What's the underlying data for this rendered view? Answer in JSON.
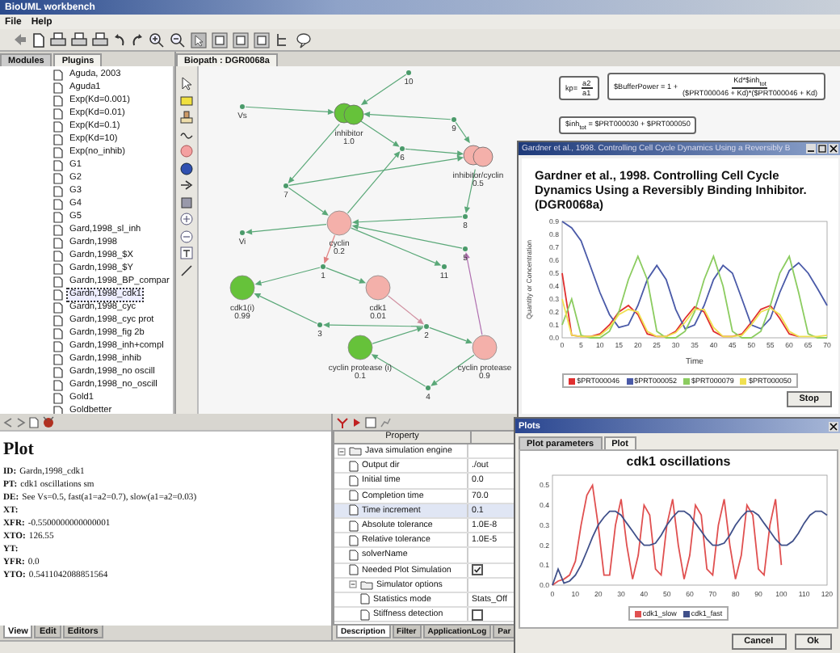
{
  "window": {
    "title": "BioUML workbench"
  },
  "menu": [
    "File",
    "Help"
  ],
  "left_panel": {
    "tabs": [
      {
        "label": "Modules",
        "selected": false
      },
      {
        "label": "Plugins",
        "selected": true
      }
    ],
    "tree": [
      {
        "label": "Aguda, 2003",
        "selected": false
      },
      {
        "label": "Aguda1",
        "selected": false
      },
      {
        "label": "Exp(Kd=0.001)",
        "selected": false
      },
      {
        "label": "Exp(Kd=0.01)",
        "selected": false
      },
      {
        "label": "Exp(Kd=0.1)",
        "selected": false
      },
      {
        "label": "Exp(Kd=10)",
        "selected": false
      },
      {
        "label": "Exp(no_inhib)",
        "selected": false
      },
      {
        "label": "G1",
        "selected": false
      },
      {
        "label": "G2",
        "selected": false
      },
      {
        "label": "G3",
        "selected": false
      },
      {
        "label": "G4",
        "selected": false
      },
      {
        "label": "G5",
        "selected": false
      },
      {
        "label": "Gard,1998_sl_inh",
        "selected": false
      },
      {
        "label": "Gardn,1998",
        "selected": false
      },
      {
        "label": "Gardn,1998_$X",
        "selected": false
      },
      {
        "label": "Gardn,1998_$Y",
        "selected": false
      },
      {
        "label": "Gardn,1998_BP_compar",
        "selected": false
      },
      {
        "label": "Gardn,1998_cdk1",
        "selected": true
      },
      {
        "label": "Gardn,1998_cyc",
        "selected": false
      },
      {
        "label": "Gardn,1998_cyc prot",
        "selected": false
      },
      {
        "label": "Gardn,1998_fig 2b",
        "selected": false
      },
      {
        "label": "Gardn,1998_inh+compl",
        "selected": false
      },
      {
        "label": "Gardn,1998_inhib",
        "selected": false
      },
      {
        "label": "Gardn,1998_no oscill",
        "selected": false
      },
      {
        "label": "Gardn,1998_no_oscill",
        "selected": false
      },
      {
        "label": "Gold1",
        "selected": false
      },
      {
        "label": "Goldbetter",
        "selected": false
      }
    ]
  },
  "diagram": {
    "tab": {
      "label": "Biopath : DGR0068a",
      "selected": true
    },
    "nodes": [
      {
        "kind": "reaction",
        "label": "10"
      },
      {
        "kind": "reaction",
        "label": "Vs"
      },
      {
        "kind": "complex",
        "label": "inhibitor",
        "value": "1.0",
        "color": "#66c23a"
      },
      {
        "kind": "reaction",
        "label": "9"
      },
      {
        "kind": "complex",
        "label": "inhibitor/cyclin",
        "value": "0.5",
        "color": "#f4b0aa"
      },
      {
        "kind": "reaction",
        "label": "6"
      },
      {
        "kind": "reaction",
        "label": "7"
      },
      {
        "kind": "species",
        "label": "cyclin",
        "value": "0.2",
        "color": "#f4b0aa"
      },
      {
        "kind": "reaction",
        "label": "8"
      },
      {
        "kind": "reaction",
        "label": "Vi"
      },
      {
        "kind": "reaction",
        "label": "5"
      },
      {
        "kind": "reaction",
        "label": "11"
      },
      {
        "kind": "reaction",
        "label": "1"
      },
      {
        "kind": "species",
        "label": "cdk1(i)",
        "value": "0.99",
        "color": "#66c23a"
      },
      {
        "kind": "species",
        "label": "cdk1",
        "value": "0.01",
        "color": "#f4b0aa"
      },
      {
        "kind": "reaction",
        "label": "3"
      },
      {
        "kind": "reaction",
        "label": "2"
      },
      {
        "kind": "species",
        "label": "cyclin protease (i)",
        "value": "0.1",
        "color": "#66c23a"
      },
      {
        "kind": "species",
        "label": "cyclin protease",
        "value": "0.9",
        "color": "#f4b0aa"
      },
      {
        "kind": "reaction",
        "label": "4"
      }
    ],
    "formulas": [
      {
        "lhs": "kp=",
        "numerator": "a2",
        "denominator": "a1"
      },
      {
        "lhs": "$BufferPower = 1 +",
        "numerator": "Kd*$inh$_{tot}$",
        "denominator": "($PRT000046 + Kd)*($PRT000046 + Kd)"
      },
      {
        "lhs": "$inh$_{tot}$ = $PRT000030 + $PRT000050"
      }
    ]
  },
  "result_window": {
    "title": "Gardner et al., 1998. Controlling Cell Cycle Dynamics Using a Reversibly B",
    "chart_data": {
      "type": "line",
      "title": "Gardner et al., 1998. Controlling Cell Cycle Dynamics Using a Reversibly Binding Inhibitor. (DGR0068a)",
      "xlabel": "Time",
      "ylabel": "Quantity or Concentration",
      "x": [
        0,
        2.5,
        5,
        7.5,
        10,
        12.5,
        15,
        17.5,
        20,
        22.5,
        25,
        27.5,
        30,
        32.5,
        35,
        37.5,
        40,
        42.5,
        45,
        47.5,
        50,
        52.5,
        55,
        57.5,
        60,
        62.5,
        65,
        67.5,
        70
      ],
      "series": [
        {
          "name": "$PRT000046",
          "color": "#e03030",
          "values": [
            0.5,
            0.02,
            0.01,
            0.01,
            0.03,
            0.1,
            0.2,
            0.25,
            0.18,
            0.03,
            0.01,
            0.01,
            0.05,
            0.15,
            0.24,
            0.2,
            0.05,
            0.01,
            0.01,
            0.03,
            0.12,
            0.22,
            0.25,
            0.15,
            0.03,
            0.01,
            null,
            null,
            null
          ]
        },
        {
          "name": "$PRT000052",
          "color": "#4a5aa8",
          "values": [
            0.9,
            0.85,
            0.75,
            0.55,
            0.35,
            0.18,
            0.08,
            0.1,
            0.25,
            0.45,
            0.56,
            0.45,
            0.22,
            0.07,
            0.1,
            0.25,
            0.45,
            0.56,
            0.5,
            0.3,
            0.1,
            0.07,
            0.15,
            0.35,
            0.52,
            0.58,
            0.5,
            0.38,
            0.25
          ]
        },
        {
          "name": "$PRT000079",
          "color": "#8ccc60",
          "values": [
            0.1,
            0.3,
            0.02,
            0,
            0,
            0.05,
            0.2,
            0.45,
            0.63,
            0.45,
            0.05,
            0,
            0,
            0.05,
            0.2,
            0.45,
            0.63,
            0.4,
            0.05,
            0,
            0,
            0.05,
            0.25,
            0.5,
            0.63,
            0.35,
            0.03,
            0,
            0
          ]
        },
        {
          "name": "$PRT000050",
          "color": "#f0e050",
          "values": [
            0.3,
            0.02,
            0.01,
            0.01,
            0.02,
            0.08,
            0.18,
            0.22,
            0.2,
            0.05,
            0.01,
            0.01,
            0.04,
            0.12,
            0.22,
            0.22,
            0.08,
            0.01,
            0.01,
            0.02,
            0.1,
            0.2,
            0.23,
            0.18,
            0.05,
            0.01,
            0.01,
            0.01,
            0.02
          ]
        }
      ],
      "xlim": [
        0,
        70
      ],
      "ylim": [
        0,
        0.9
      ],
      "xticks": [
        0,
        5,
        10,
        15,
        20,
        25,
        30,
        35,
        40,
        45,
        50,
        55,
        60,
        65,
        70
      ],
      "yticks": [
        {
          "value": 0,
          "label": "0.0"
        },
        {
          "value": 0.1,
          "label": "0.1"
        },
        {
          "value": 0.2,
          "label": "0.2"
        },
        {
          "value": 0.3,
          "label": "0.3"
        },
        {
          "value": 0.4,
          "label": "0.4"
        },
        {
          "value": 0.5,
          "label": "0.5"
        },
        {
          "value": 0.6,
          "label": "0.6"
        },
        {
          "value": 0.7,
          "label": "0.7"
        },
        {
          "value": 0.8,
          "label": "0.8"
        },
        {
          "value": 0.9,
          "label": "0.9"
        }
      ]
    },
    "buttons": [
      "Stop"
    ]
  },
  "info_panel": {
    "heading": "Plot",
    "fields": [
      {
        "key": "ID:",
        "value": "Gardn,1998_cdk1"
      },
      {
        "key": "PT:",
        "value": "cdk1 oscillations sm"
      },
      {
        "key": "DE:",
        "value": "See Vs=0.5, fast(a1=a2=0.7), slow(a1=a2=0.03)"
      },
      {
        "key": "XT:"
      },
      {
        "key": "XFR:",
        "value": "-0.5500000000000001"
      },
      {
        "key": "XTO:",
        "value": "126.55"
      },
      {
        "key": "YT:"
      },
      {
        "key": "YFR:",
        "value": "0.0"
      },
      {
        "key": "YTO:",
        "value": "0.5411042088851564"
      }
    ],
    "tabs": [
      {
        "label": "View",
        "selected": true
      },
      {
        "label": "Edit",
        "selected": false
      },
      {
        "label": "Editors",
        "selected": false
      }
    ]
  },
  "properties": {
    "header": "Property",
    "rows": [
      {
        "kind": "group",
        "label": "Java simulation engine",
        "expanded": true,
        "selected": false,
        "children": [
          {
            "kind": "text",
            "label": "Output dir",
            "value": "./out",
            "selected": false
          },
          {
            "kind": "text",
            "label": "Initial time",
            "value": "0.0",
            "selected": false
          },
          {
            "kind": "text",
            "label": "Completion time",
            "value": "70.0",
            "selected": false
          },
          {
            "kind": "text",
            "label": "Time increment",
            "value": "0.1",
            "selected": true
          },
          {
            "kind": "text",
            "label": "Absolute tolerance",
            "value": "1.0E-8",
            "selected": false
          },
          {
            "kind": "text",
            "label": "Relative tolerance",
            "value": "1.0E-5",
            "selected": false
          },
          {
            "kind": "text",
            "label": "solverName",
            "selected": false
          },
          {
            "kind": "check",
            "label": "Needed Plot Simulation",
            "checked": true,
            "selected": false
          },
          {
            "kind": "group",
            "label": "Simulator options",
            "expanded": true,
            "selected": false,
            "children": [
              {
                "kind": "text",
                "label": "Statistics mode",
                "value": "Stats_Off",
                "selected": false
              },
              {
                "kind": "check",
                "label": "Stiffness detection",
                "checked": false,
                "selected": false
              }
            ]
          }
        ]
      }
    ],
    "tabs": [
      {
        "label": "Description",
        "selected": true
      },
      {
        "label": "Filter",
        "selected": false
      },
      {
        "label": "ApplicationLog",
        "selected": false
      },
      {
        "label": "Par",
        "selected": false
      }
    ]
  },
  "plots_window": {
    "title": "Plots",
    "tabs": [
      {
        "label": "Plot parameters",
        "selected": false
      },
      {
        "label": "Plot",
        "selected": true
      }
    ],
    "chart_data": {
      "type": "line",
      "title": "cdk1 oscillations",
      "x": [
        0,
        2.5,
        5,
        7.5,
        10,
        12.5,
        15,
        17.5,
        20,
        22.5,
        25,
        27.5,
        30,
        32.5,
        35,
        37.5,
        40,
        42.5,
        45,
        47.5,
        50,
        52.5,
        55,
        57.5,
        60,
        62.5,
        65,
        67.5,
        70,
        72.5,
        75,
        77.5,
        80,
        82.5,
        85,
        87.5,
        90,
        92.5,
        95,
        97.5,
        100,
        102.5,
        105,
        107.5,
        110,
        112.5,
        115,
        117.5,
        120
      ],
      "series": [
        {
          "name": "cdk1_slow",
          "color": "#e05050",
          "values": [
            0,
            0.02,
            0.03,
            0.05,
            0.12,
            0.3,
            0.45,
            0.5,
            0.3,
            0.05,
            0.05,
            0.3,
            0.43,
            0.2,
            0.03,
            0.15,
            0.4,
            0.35,
            0.08,
            0.05,
            0.3,
            0.43,
            0.2,
            0.03,
            0.15,
            0.4,
            0.35,
            0.08,
            0.05,
            0.3,
            0.43,
            0.2,
            0.03,
            0.15,
            0.4,
            0.35,
            0.08,
            0.05,
            0.3,
            0.43,
            0.1,
            null,
            null,
            null,
            null,
            null,
            null,
            null,
            null
          ]
        },
        {
          "name": "cdk1_fast",
          "color": "#40508a",
          "values": [
            0,
            0.08,
            0.01,
            0.02,
            0.05,
            0.1,
            0.17,
            0.24,
            0.3,
            0.34,
            0.37,
            0.37,
            0.35,
            0.31,
            0.27,
            0.23,
            0.2,
            0.2,
            0.21,
            0.25,
            0.3,
            0.34,
            0.37,
            0.37,
            0.35,
            0.31,
            0.27,
            0.23,
            0.2,
            0.2,
            0.21,
            0.25,
            0.3,
            0.34,
            0.37,
            0.37,
            0.35,
            0.31,
            0.27,
            0.23,
            0.2,
            0.2,
            0.22,
            0.26,
            0.31,
            0.35,
            0.37,
            0.37,
            0.35
          ]
        }
      ],
      "xlim": [
        0,
        120
      ],
      "ylim": [
        0,
        0.55
      ],
      "xticks": [
        0,
        10,
        20,
        30,
        40,
        50,
        60,
        70,
        80,
        90,
        100,
        110,
        120
      ],
      "yticks": [
        {
          "value": 0,
          "label": "0.0"
        },
        {
          "value": 0.1,
          "label": "0.1"
        },
        {
          "value": 0.2,
          "label": "0.2"
        },
        {
          "value": 0.3,
          "label": "0.3"
        },
        {
          "value": 0.4,
          "label": "0.4"
        },
        {
          "value": 0.5,
          "label": "0.5"
        }
      ]
    },
    "buttons": [
      "Cancel",
      "Ok"
    ]
  }
}
